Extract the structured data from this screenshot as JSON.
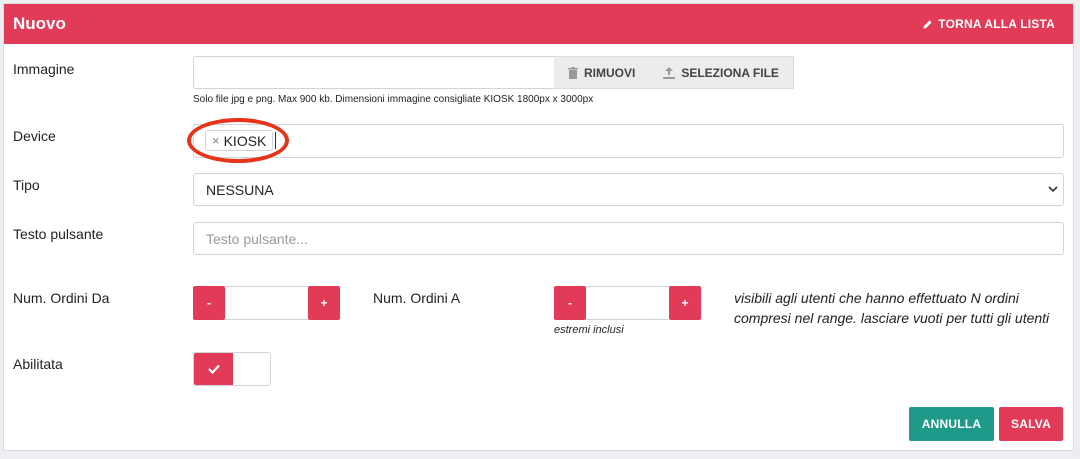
{
  "header": {
    "title": "Nuovo",
    "back_label": "TORNA ALLA LISTA",
    "color": "#e23b58"
  },
  "image_field": {
    "label": "Immagine",
    "value": "",
    "remove_label": "RIMUOVI",
    "select_label": "SELEZIONA FILE",
    "hint": "Solo file jpg e png. Max 900 kb. Dimensioni immagine consigliate KIOSK 1800px x 3000px"
  },
  "device_field": {
    "label": "Device",
    "tags": [
      "KIOSK"
    ],
    "remove_tag_glyph": "×"
  },
  "tipo_field": {
    "label": "Tipo",
    "selected": "NESSUNA"
  },
  "button_text_field": {
    "label": "Testo pulsante",
    "value": "",
    "placeholder": "Testo pulsante..."
  },
  "orders_from": {
    "label": "Num. Ordini Da",
    "value": "",
    "minus": "-",
    "plus": "+"
  },
  "orders_to": {
    "label": "Num. Ordini A",
    "value": "",
    "minus": "-",
    "plus": "+",
    "sublabel": "estremi inclusi"
  },
  "orders_note": "visibili agli utenti che hanno effettuato N ordini compresi nel range. lasciare vuoti per tutti gli utenti",
  "enabled_field": {
    "label": "Abilitata",
    "value": true
  },
  "actions": {
    "cancel_label": "ANNULLA",
    "save_label": "SALVA",
    "cancel_color": "#1f9a8a",
    "save_color": "#e23b58"
  }
}
